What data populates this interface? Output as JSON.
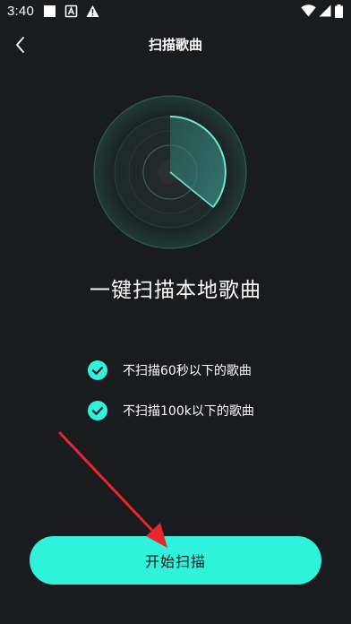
{
  "status_bar": {
    "time": "3:40",
    "icons": [
      "notification-square-icon",
      "text-a-icon",
      "warning-icon",
      "wifi-icon",
      "signal-icon",
      "battery-icon"
    ]
  },
  "header": {
    "title": "扫描歌曲",
    "back_icon": "chevron-left-icon"
  },
  "main": {
    "title": "一键扫描本地歌曲",
    "options": [
      {
        "label": "不扫描60秒以下的歌曲",
        "checked": true
      },
      {
        "label": "不扫描100k以下的歌曲",
        "checked": true
      }
    ],
    "start_button": "开始扫描"
  },
  "colors": {
    "background": "#1a1b1f",
    "accent": "#2ef2d9",
    "annotation_arrow": "#e8262b"
  }
}
